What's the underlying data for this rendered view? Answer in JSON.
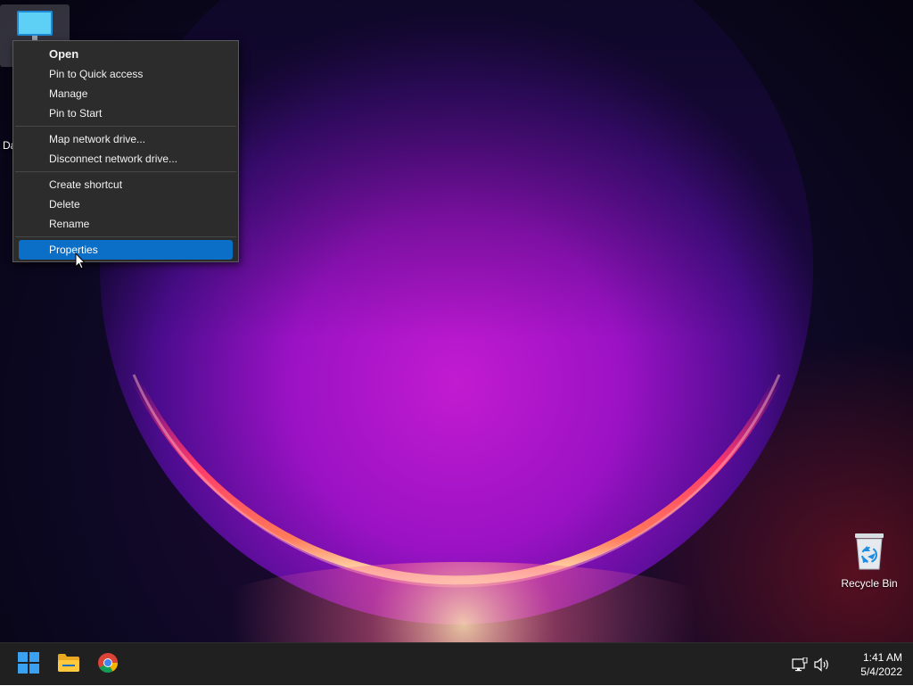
{
  "desktop": {
    "this_pc": {
      "label_fragment": "Da",
      "icon": "monitor-icon"
    },
    "recycle_bin": {
      "label": "Recycle Bin",
      "icon": "recycle-bin-icon"
    }
  },
  "context_menu": {
    "items": [
      {
        "label": "Open",
        "bold": true
      },
      {
        "label": "Pin to Quick access"
      },
      {
        "label": "Manage"
      },
      {
        "label": "Pin to Start"
      },
      {
        "label": "Map network drive..."
      },
      {
        "label": "Disconnect network drive..."
      },
      {
        "label": "Create shortcut"
      },
      {
        "label": "Delete"
      },
      {
        "label": "Rename"
      },
      {
        "label": "Properties",
        "selected": true
      }
    ],
    "selection_color": "#0b6ec7"
  },
  "taskbar": {
    "buttons": [
      {
        "icon": "windows-logo-icon",
        "role": "start"
      },
      {
        "icon": "folder-icon",
        "role": "file-explorer"
      },
      {
        "icon": "chrome-icon",
        "role": "browser"
      }
    ],
    "tray_icons": [
      "network-icon",
      "volume-icon"
    ],
    "clock": {
      "time": "1:41 AM",
      "date": "5/4/2022"
    }
  },
  "colors": {
    "accent": "#0b6ec7",
    "taskbar_bg": "#202020",
    "menu_bg": "#2c2c2c"
  }
}
